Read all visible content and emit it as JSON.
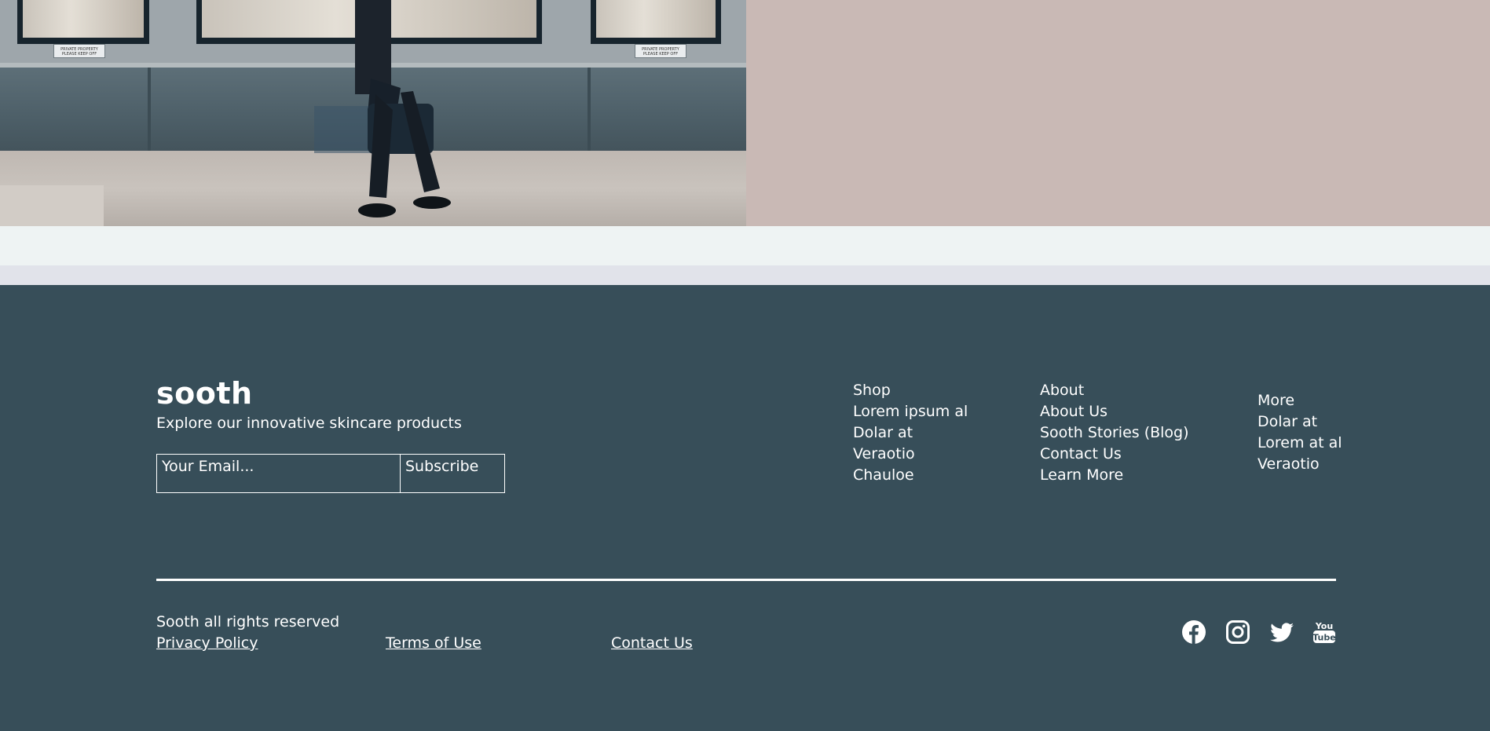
{
  "hero": {
    "photo_signs": [
      "PRIVATE PROPERTY PLEASE KEEP OFF",
      "PRIVATE PROPERTY PLEASE KEEP OFF"
    ]
  },
  "footer": {
    "brand": "sooth",
    "tagline": "Explore our innovative skincare products",
    "email_placeholder": "Your Email...",
    "subscribe_label": "Subscribe",
    "columns": [
      {
        "items": [
          "Shop",
          "Lorem ipsum al",
          "Dolar at",
          "Veraotio",
          "Chauloe"
        ]
      },
      {
        "items": [
          "About",
          "About Us",
          "Sooth Stories (Blog)",
          "Contact Us",
          "Learn More"
        ]
      },
      {
        "items": [
          "More",
          "Dolar at",
          "Lorem at al",
          "Veraotio"
        ]
      }
    ],
    "rights": "Sooth all rights reserved",
    "links": {
      "privacy": "Privacy Policy",
      "terms": "Terms of Use",
      "contact": "Contact Us"
    },
    "social_icons": [
      "facebook-icon",
      "instagram-icon",
      "twitter-icon",
      "youtube-icon"
    ],
    "colors": {
      "background": "#374e59",
      "text": "#ffffff"
    }
  }
}
